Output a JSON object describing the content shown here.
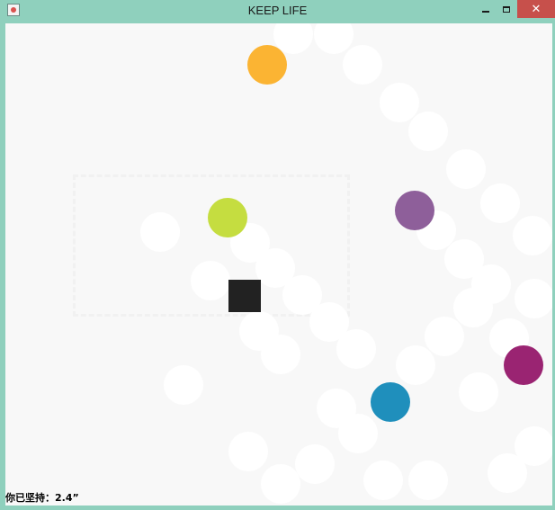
{
  "window": {
    "title": "KEEP LIFE",
    "icon": "java-app-icon",
    "buttons": [
      "minimize-icon",
      "maximize-icon",
      "close-icon"
    ]
  },
  "colors": {
    "frame": "#8fd0bd",
    "background": "#f8f8f8",
    "trail": "#ffffff",
    "player": "#222222",
    "close_button": "#c7504b"
  },
  "balls": [
    {
      "name": "orange",
      "color": "#fbb433"
    },
    {
      "name": "lime",
      "color": "#c5dd40"
    },
    {
      "name": "purple",
      "color": "#8e5f9a"
    },
    {
      "name": "magenta",
      "color": "#9a2472"
    },
    {
      "name": "blue",
      "color": "#1f8fbc"
    }
  ],
  "status": {
    "timer_label": "你已坚持：",
    "timer_value": "2.4”"
  }
}
